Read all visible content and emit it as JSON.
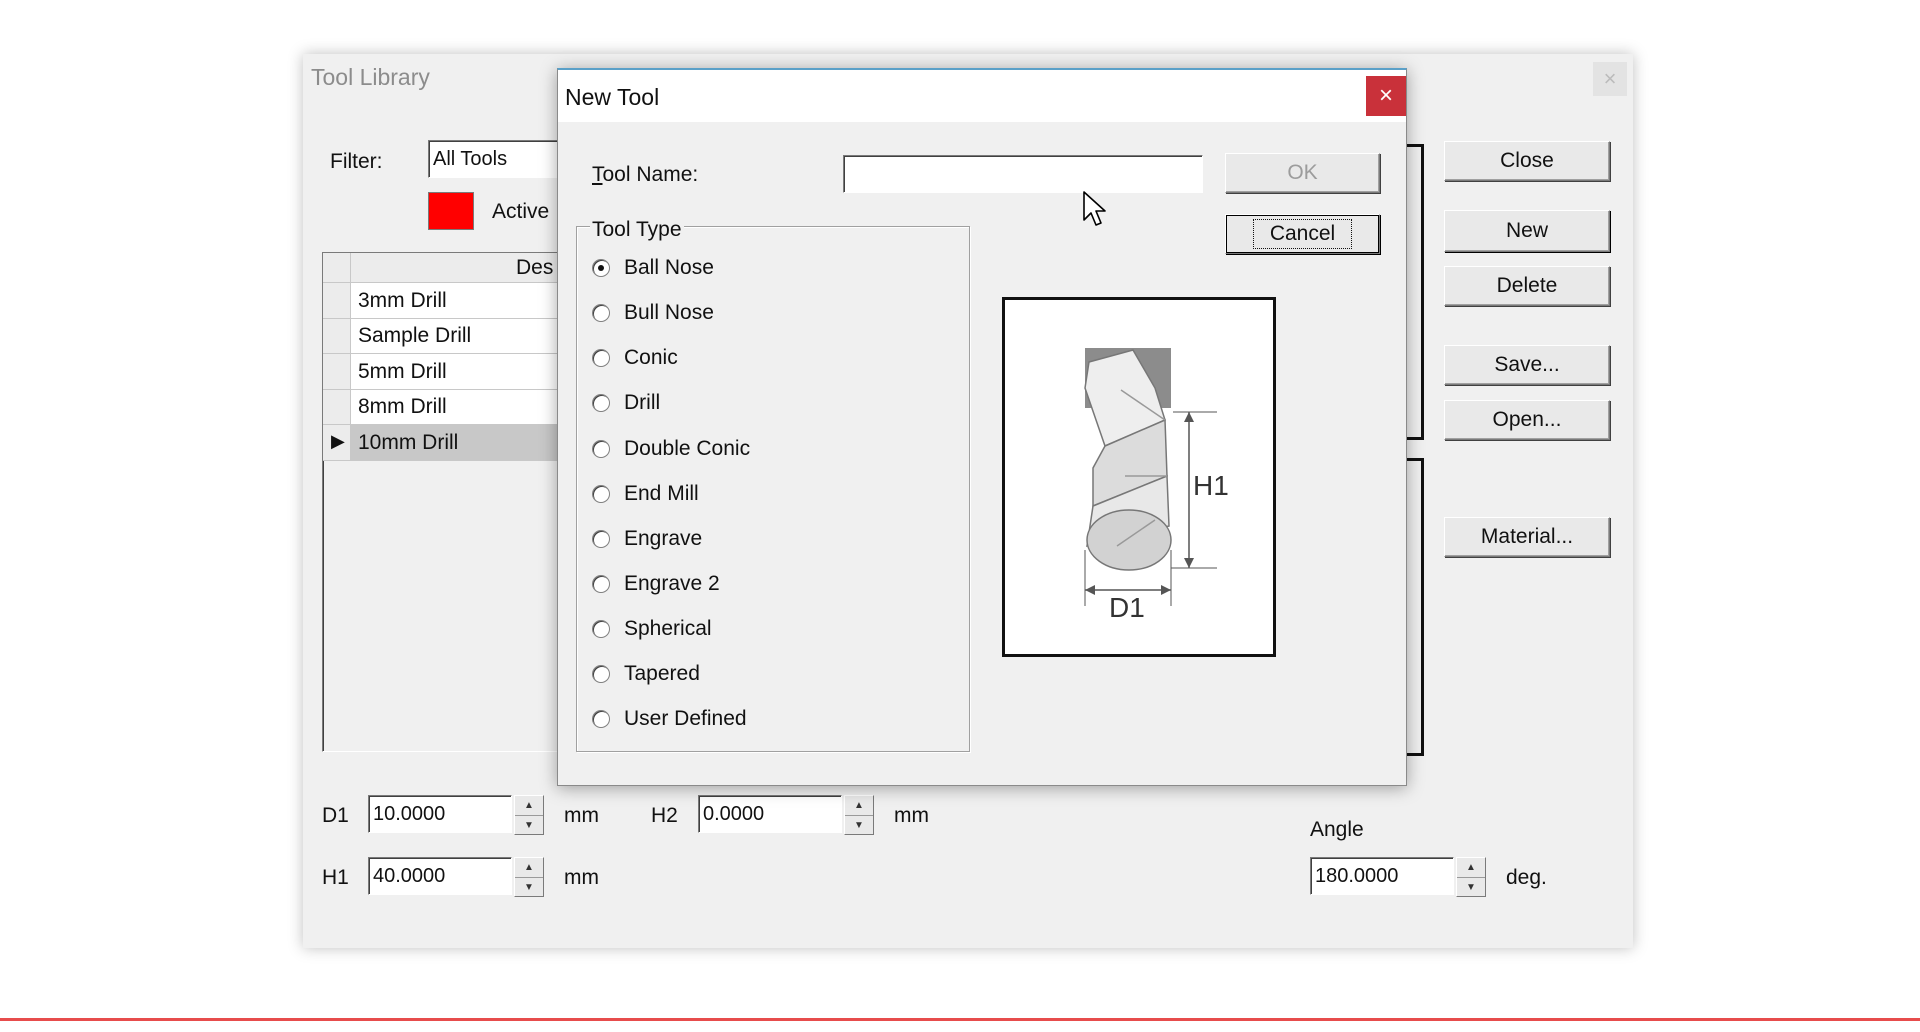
{
  "tool_library": {
    "title": "Tool Library",
    "filter_label": "Filter:",
    "filter_value": "All Tools",
    "active_label": "Active",
    "active_color": "#ff0000",
    "grid_header": "Des",
    "rows": [
      "3mm Drill",
      "Sample Drill",
      "5mm Drill",
      "8mm Drill",
      "10mm Drill"
    ],
    "selected_row": "10mm Drill",
    "buttons": {
      "close": "Close",
      "new": "New",
      "delete": "Delete",
      "save": "Save...",
      "open": "Open...",
      "material": "Material..."
    },
    "d1": {
      "label": "D1",
      "value": "10.0000",
      "unit": "mm"
    },
    "h2": {
      "label": "H2",
      "value": "0.0000",
      "unit": "mm"
    },
    "h1": {
      "label": "H1",
      "value": "40.0000",
      "unit": "mm"
    },
    "angle": {
      "label": "Angle",
      "value": "180.0000",
      "unit": "deg."
    }
  },
  "new_tool": {
    "title": "New Tool",
    "close_glyph": "×",
    "tool_name_label": "Tool Name:",
    "tool_name_value": "",
    "ok_label": "OK",
    "cancel_label": "Cancel",
    "tool_type_label": "Tool Type",
    "tool_types": [
      "Ball Nose",
      "Bull Nose",
      "Conic",
      "Drill",
      "Double Conic",
      "End Mill",
      "Engrave",
      "Engrave 2",
      "Spherical",
      "Tapered",
      "User Defined"
    ],
    "selected_type": "Ball Nose",
    "diagram": {
      "h1_label": "H1",
      "d1_label": "D1"
    }
  },
  "colors": {
    "close_button": "#c9313a",
    "accent_line": "#e74c4c"
  }
}
